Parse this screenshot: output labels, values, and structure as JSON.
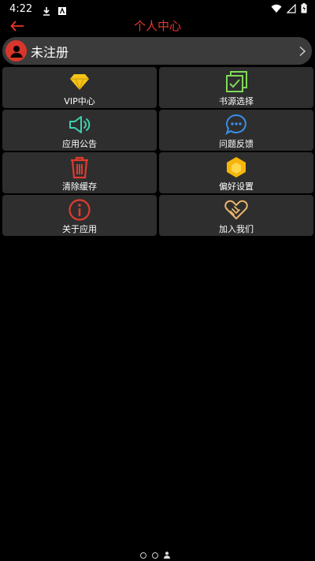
{
  "status_bar": {
    "time": "4:22"
  },
  "header": {
    "title": "个人中心"
  },
  "user": {
    "name": "未注册"
  },
  "menu": [
    {
      "label": "VIP中心",
      "icon": "diamond-icon",
      "color": "#f5c518"
    },
    {
      "label": "书源选择",
      "icon": "checkbox-stack-icon",
      "color": "#7ed957"
    },
    {
      "label": "应用公告",
      "icon": "speaker-icon",
      "color": "#3fd0b0"
    },
    {
      "label": "问题反馈",
      "icon": "chat-bubble-icon",
      "color": "#3a8ee6"
    },
    {
      "label": "清除缓存",
      "icon": "trash-icon",
      "color": "#e03a30"
    },
    {
      "label": "偏好设置",
      "icon": "hexagon-icon",
      "color": "#f5b50c"
    },
    {
      "label": "关于应用",
      "icon": "info-icon",
      "color": "#e03a30"
    },
    {
      "label": "加入我们",
      "icon": "handshake-icon",
      "color": "#e8b36a"
    }
  ],
  "colors": {
    "accent": "#e8362b",
    "tile_bg": "#2e2e2e",
    "user_bar_bg": "#3b3b3b"
  }
}
